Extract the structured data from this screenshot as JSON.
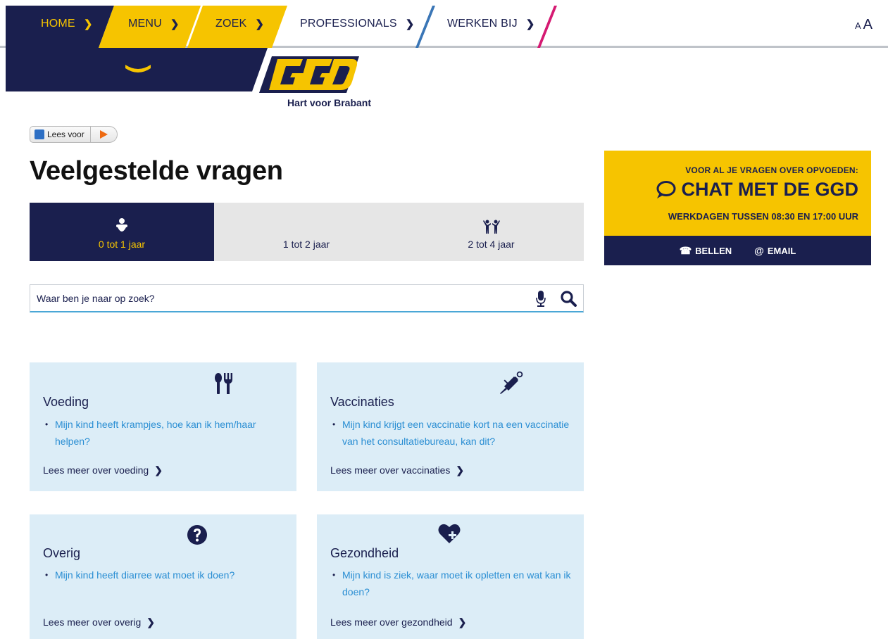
{
  "nav": {
    "items": [
      {
        "label": "HOME",
        "chevron": "❯"
      },
      {
        "label": "MENU",
        "chevron": "❯"
      },
      {
        "label": "ZOEK",
        "chevron": "❯"
      },
      {
        "label": "PROFESSIONALS",
        "chevron": "❯"
      },
      {
        "label": "WERKEN BIJ",
        "chevron": "❯"
      }
    ],
    "font_small": "A",
    "font_big": "A"
  },
  "logo": {
    "text": "GGD",
    "subtitle": "Hart voor Brabant"
  },
  "lees_voor": {
    "label": "Lees voor"
  },
  "page": {
    "title": "Veelgestelde vragen"
  },
  "tabs": [
    {
      "label": "0 tot 1 jaar",
      "icon": "baby-icon",
      "active": true
    },
    {
      "label": "1 tot 2 jaar",
      "icon": "",
      "active": false
    },
    {
      "label": "2 tot 4 jaar",
      "icon": "children-icon",
      "active": false
    }
  ],
  "search": {
    "placeholder": "Waar ben je naar op zoek?",
    "value": ""
  },
  "cards": [
    {
      "title": "Voeding",
      "icon": "cutlery-icon",
      "questions": [
        "Mijn kind heeft krampjes, hoe kan ik hem/haar helpen?"
      ],
      "more": "Lees meer over voeding"
    },
    {
      "title": "Vaccinaties",
      "icon": "syringe-icon",
      "questions": [
        "Mijn kind krijgt een vaccinatie kort na een vaccinatie van het consultatiebureau, kan dit?"
      ],
      "more": "Lees meer over vaccinaties"
    },
    {
      "title": "Overig",
      "icon": "question-icon",
      "questions": [
        "Mijn kind heeft diarree wat moet ik doen?"
      ],
      "more": "Lees meer over overig"
    },
    {
      "title": "Gezondheid",
      "icon": "heart-plus-icon",
      "questions": [
        "Mijn kind is ziek, waar moet ik opletten en wat kan ik doen?"
      ],
      "more": "Lees meer over gezondheid"
    }
  ],
  "more_chevron": "❯",
  "chat": {
    "pre": "VOOR AL JE VRAGEN OVER OPVOEDEN:",
    "main": "CHAT MET DE GGD",
    "hours": "WERKDAGEN TUSSEN 08:30 EN 17:00 UUR",
    "call": "BELLEN",
    "email": "EMAIL"
  },
  "colors": {
    "navy": "#1a1f4e",
    "yellow": "#f6c400",
    "light_blue": "#dcedf7",
    "link_blue": "#2a8ed3",
    "grey": "#e6e6e6"
  }
}
